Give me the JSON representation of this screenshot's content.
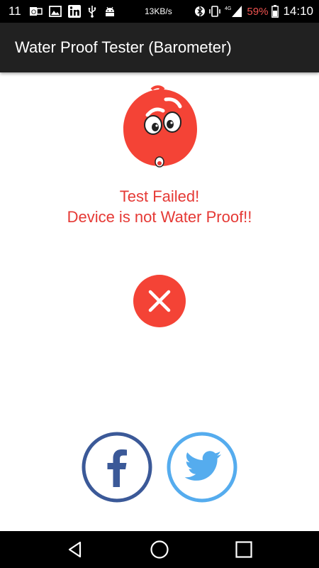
{
  "status_bar": {
    "notification_count": "11",
    "net_speed": "13KB/s",
    "battery_percent": "59%",
    "time": "14:10",
    "battery_color": "#ef5350",
    "left_icons": [
      "outlook-icon",
      "image-icon",
      "linkedin-icon",
      "usb-icon",
      "android-debug-icon"
    ],
    "right_icons": [
      "bluetooth-icon",
      "vibrate-icon",
      "signal-4g-icon",
      "battery-icon"
    ]
  },
  "app_bar": {
    "title": "Water Proof Tester (Barometer)",
    "background": "#212121"
  },
  "result": {
    "line1": "Test Failed!",
    "line2": "Device is not Water Proof!!",
    "color": "#e53935"
  },
  "mascot": {
    "icon": "sad-red-drop-face-icon",
    "color": "#f44336"
  },
  "fail_indicator": {
    "icon": "close-icon",
    "color": "#f44336"
  },
  "social": {
    "facebook": {
      "icon": "facebook-icon",
      "color": "#3b5998"
    },
    "twitter": {
      "icon": "twitter-icon",
      "color": "#55acee"
    }
  },
  "nav_bar": {
    "buttons": [
      "back-icon",
      "home-icon",
      "recents-icon"
    ]
  }
}
